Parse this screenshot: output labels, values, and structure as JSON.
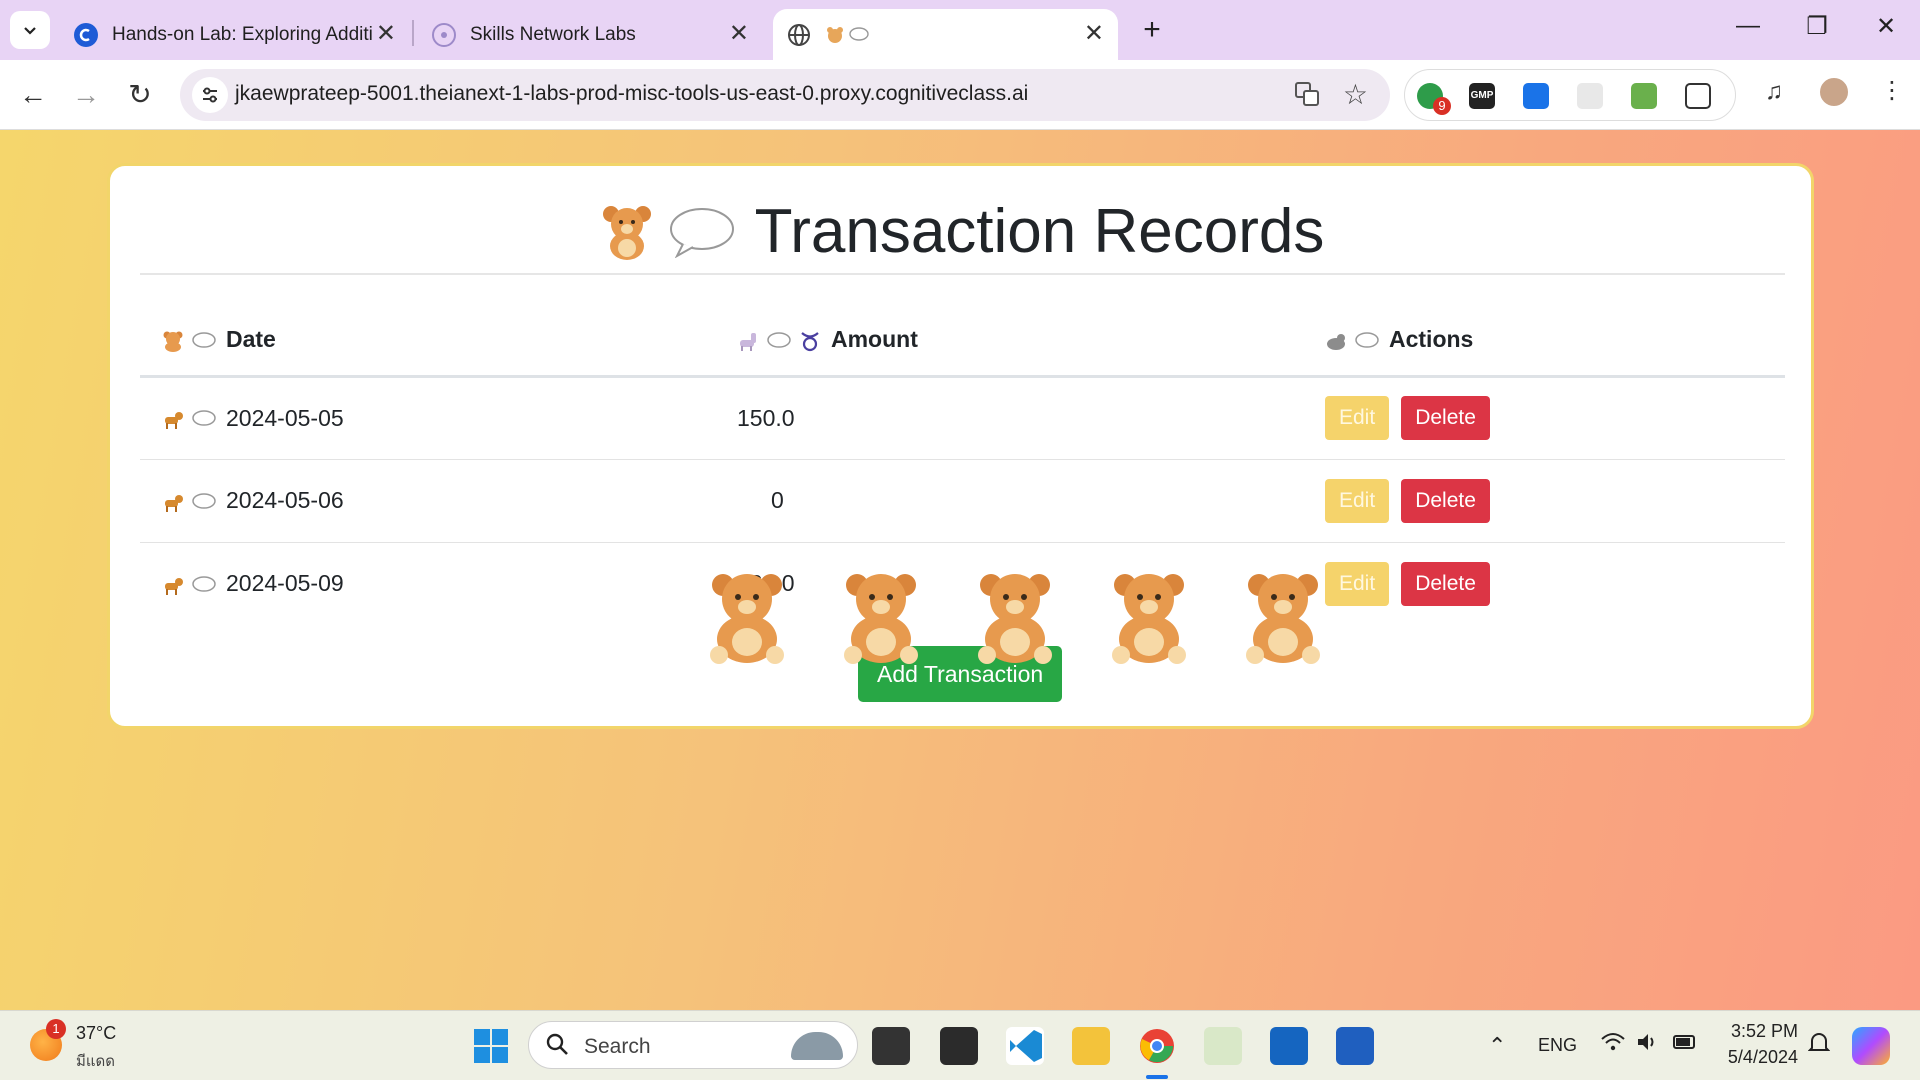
{
  "browser": {
    "tabs": [
      {
        "title": "Hands-on Lab: Exploring Additi",
        "icon": "cognitiveclass-icon"
      },
      {
        "title": "Skills Network Labs",
        "icon": "skills-network-icon"
      },
      {
        "title": "",
        "icon": "globe-icon",
        "emoji_title": "bear-speech"
      }
    ],
    "url": "jkaewprateep-5001.theianext-1-labs-prod-misc-tools-us-east-0.proxy.cognitiveclass.ai",
    "extension_badge": "9",
    "gmp_label": "GMP"
  },
  "page": {
    "heading": "Transaction Records",
    "columns": [
      "Date",
      "Amount",
      "Actions"
    ],
    "rows": [
      {
        "date": "2024-05-05",
        "amount": "150.0"
      },
      {
        "date": "2024-05-06",
        "amount": "0"
      },
      {
        "date": "2024-05-09",
        "amount": "320.0"
      }
    ],
    "edit_label": "Edit",
    "delete_label": "Delete",
    "add_label": "Add Transaction",
    "colors": {
      "edit": "#f5d36b",
      "delete": "#dc3545",
      "add": "#28a745"
    }
  },
  "taskbar": {
    "weather_temp": "37°C",
    "weather_desc": "มีแดด",
    "weather_badge": "1",
    "search_label": "Search",
    "lang": "ENG",
    "time": "3:52 PM",
    "date": "5/4/2024"
  }
}
